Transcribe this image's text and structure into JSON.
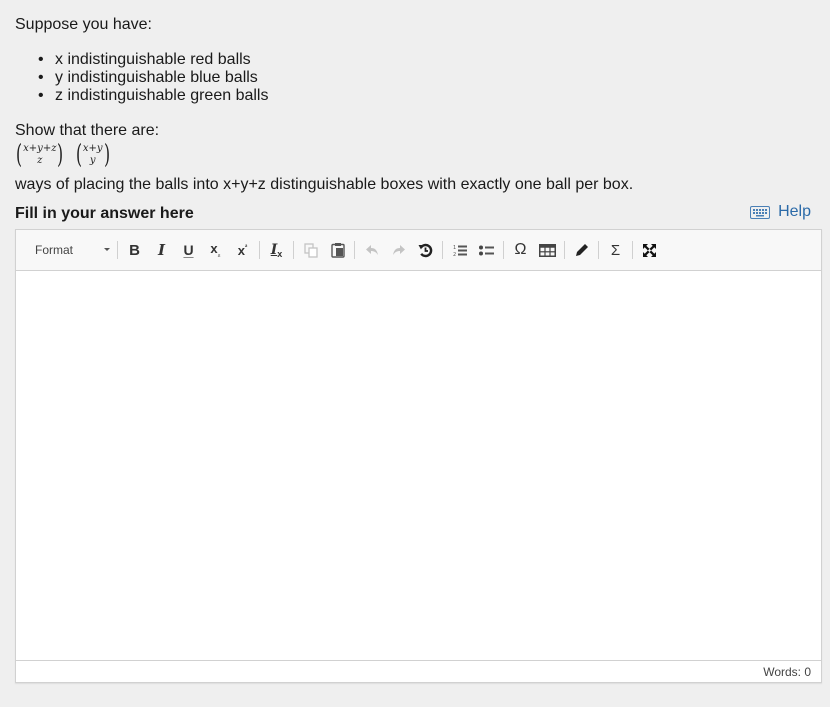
{
  "question": {
    "intro": "Suppose you have:",
    "items": [
      "x indistinguishable red balls",
      "y indistinguishable blue balls",
      "z indistinguishable green balls"
    ],
    "show_text": "Show that there are:",
    "formula": {
      "binom1": {
        "top": "x+y+z",
        "bottom": "z"
      },
      "binom2": {
        "top": "x+y",
        "bottom": "y"
      },
      "left_paren": "(",
      "right_paren": ")"
    },
    "ways_text": "ways of placing the balls into x+y+z distinguishable boxes with exactly one ball per box."
  },
  "answer": {
    "label": "Fill in your answer here",
    "help_label": "Help",
    "help_icon": "keyboard-icon"
  },
  "toolbar": {
    "format_label": "Format",
    "buttons": {
      "bold": "B",
      "italic": "I",
      "underline": "U",
      "subscript": "x",
      "subscript_small": "₂",
      "superscript": "x",
      "superscript_small": "²",
      "remove_format": "I",
      "remove_format_small": "x",
      "copy": "⧉",
      "paste": "📋",
      "undo": "➦",
      "redo": "➦",
      "history": "↺",
      "numbered_list": "≡",
      "bulleted_list": "☷",
      "special_char": "Ω",
      "table": "▦",
      "pen": "✎",
      "sum": "Σ",
      "maximize": "⤧"
    },
    "disabled": [
      "copy",
      "undo",
      "redo"
    ]
  },
  "editor": {
    "content": "",
    "word_count_label": "Words: 0"
  }
}
